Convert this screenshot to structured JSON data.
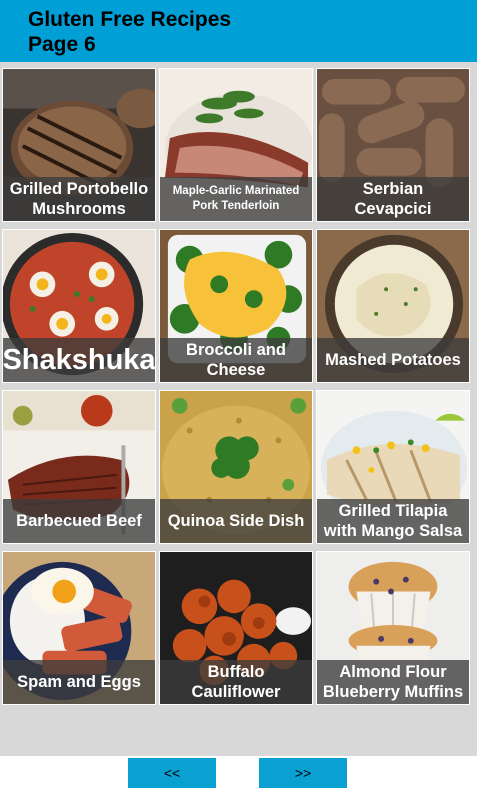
{
  "header": {
    "title_line1": "Gluten Free Recipes",
    "title_line2": "Page 6",
    "color": "#00a0d6"
  },
  "recipes": [
    {
      "label": "Grilled Portobello Mushrooms",
      "line1": "Grilled Portobello",
      "line2": "Mushrooms"
    },
    {
      "label": "Maple-Garlic Marinated Pork Tenderloin",
      "line1": "Maple-Garlic Marinated",
      "line2": "Pork Tenderloin"
    },
    {
      "label": "Serbian Cevapcici",
      "line1": "Serbian",
      "line2": "Cevapcici"
    },
    {
      "label": "Shakshuka",
      "line1": "Shakshuka",
      "line2": ""
    },
    {
      "label": "Broccoli and Cheese",
      "line1": "Broccoli and",
      "line2": "Cheese"
    },
    {
      "label": "Mashed Potatoes",
      "line1": "Mashed Potatoes",
      "line2": ""
    },
    {
      "label": "Barbecued Beef",
      "line1": "Barbecued Beef",
      "line2": ""
    },
    {
      "label": "Quinoa Side Dish",
      "line1": "Quinoa Side Dish",
      "line2": ""
    },
    {
      "label": "Grilled Tilapia with Mango Salsa",
      "line1": "Grilled Tilapia",
      "line2": "with Mango Salsa"
    },
    {
      "label": "Spam and Eggs",
      "line1": "Spam and Eggs",
      "line2": ""
    },
    {
      "label": "Buffalo Cauliflower",
      "line1": "Buffalo",
      "line2": "Cauliflower"
    },
    {
      "label": "Almond Flour Blueberry Muffins",
      "line1": "Almond Flour",
      "line2": "Blueberry Muffins"
    }
  ],
  "navigation": {
    "prev_label": "<<",
    "next_label": ">>",
    "button_color": "#0aa1d2"
  }
}
